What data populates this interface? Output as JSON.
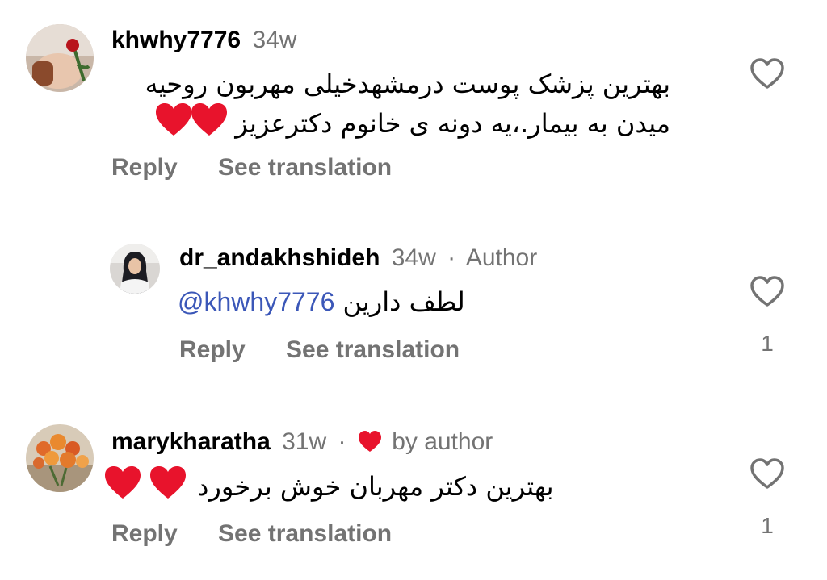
{
  "comments": [
    {
      "username": "khwhy7776",
      "time": "34w",
      "line1": "بهترین پزشک پوست درمشهدخیلی مهربون روحیه",
      "line2": "میدن به بیمار.،یه دونه ی خانوم دکترعزیز",
      "reply_label": "Reply",
      "translate_label": "See translation",
      "like_count": ""
    },
    {
      "username": "dr_andakhshideh",
      "time": "34w",
      "badge": "Author",
      "mention": "@khwhy7776",
      "text": "لطف دارین",
      "reply_label": "Reply",
      "translate_label": "See translation",
      "like_count": "1"
    },
    {
      "username": "marykharatha",
      "time": "31w",
      "badge": "by author",
      "text": "بهترین دکتر مهربان خوش برخورد",
      "reply_label": "Reply",
      "translate_label": "See translation",
      "like_count": "1"
    }
  ],
  "colors": {
    "meta_gray": "#737373",
    "mention_blue": "#3b57b8",
    "heart_red": "#e8132c"
  },
  "icons": {
    "like": "heart-outline-icon",
    "liked_by_author": "heart-filled-icon",
    "emoji": "red-heart-emoji"
  }
}
